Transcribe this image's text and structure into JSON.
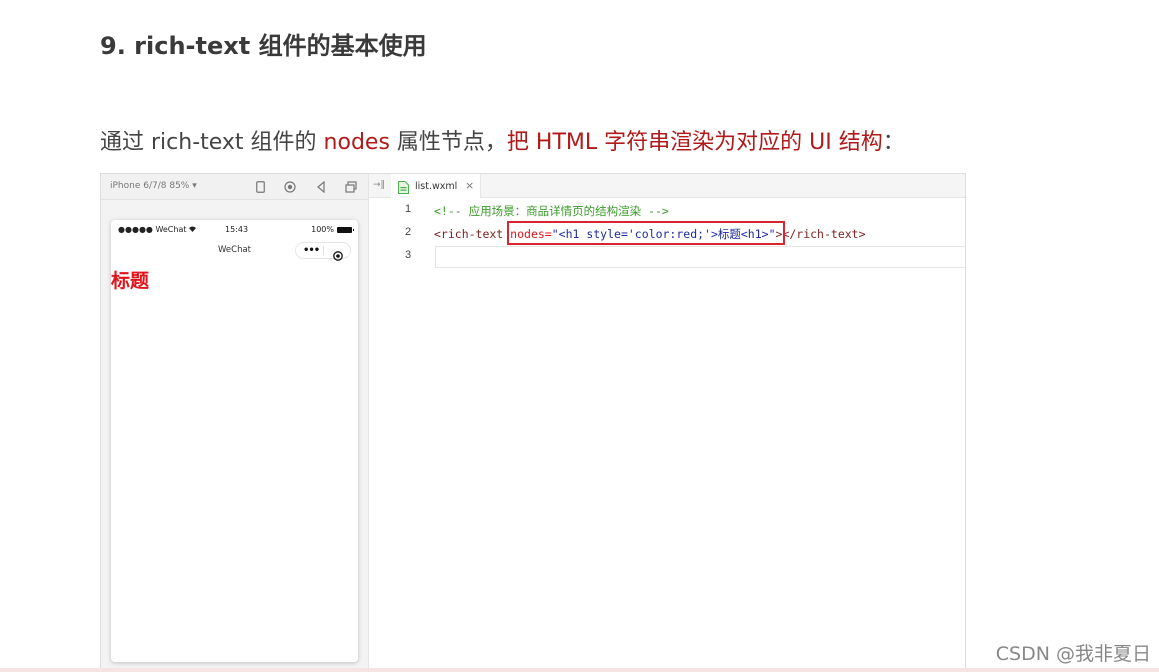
{
  "heading": "9. rich-text 组件的基本使用",
  "description": {
    "part1": "通过 rich-text 组件的 ",
    "part2": "nodes",
    "part3": " 属性节点，",
    "part4": "把 HTML 字符串渲染为对应的 UI 结构",
    "part5": "："
  },
  "simulator": {
    "device_label": "iPhone 6/7/8 85% ▾",
    "status": {
      "carrier": "●●●●● WeChat",
      "time": "15:43",
      "battery_text": "100%"
    },
    "nav_title": "WeChat",
    "rendered_heading": "标题"
  },
  "editor": {
    "tab_label": "list.wxml",
    "tab_close": "×",
    "lines": [
      {
        "num": "1",
        "comment": "<!-- 应用场景：商品详情页的结构渲染 -->"
      },
      {
        "num": "2",
        "tag_open": "<rich-text ",
        "attr": "nodes=",
        "value": "\"<h1 style='color:red;'>标题<h1>\"",
        "tag_close": "></rich-text>"
      },
      {
        "num": "3"
      }
    ]
  },
  "watermark": "CSDN @我非夏日",
  "colors": {
    "accent_red": "#b01a1a",
    "rendered_red": "#e0141a",
    "highlight_box": "#d8262e",
    "comment_green": "#3a9a2a"
  }
}
